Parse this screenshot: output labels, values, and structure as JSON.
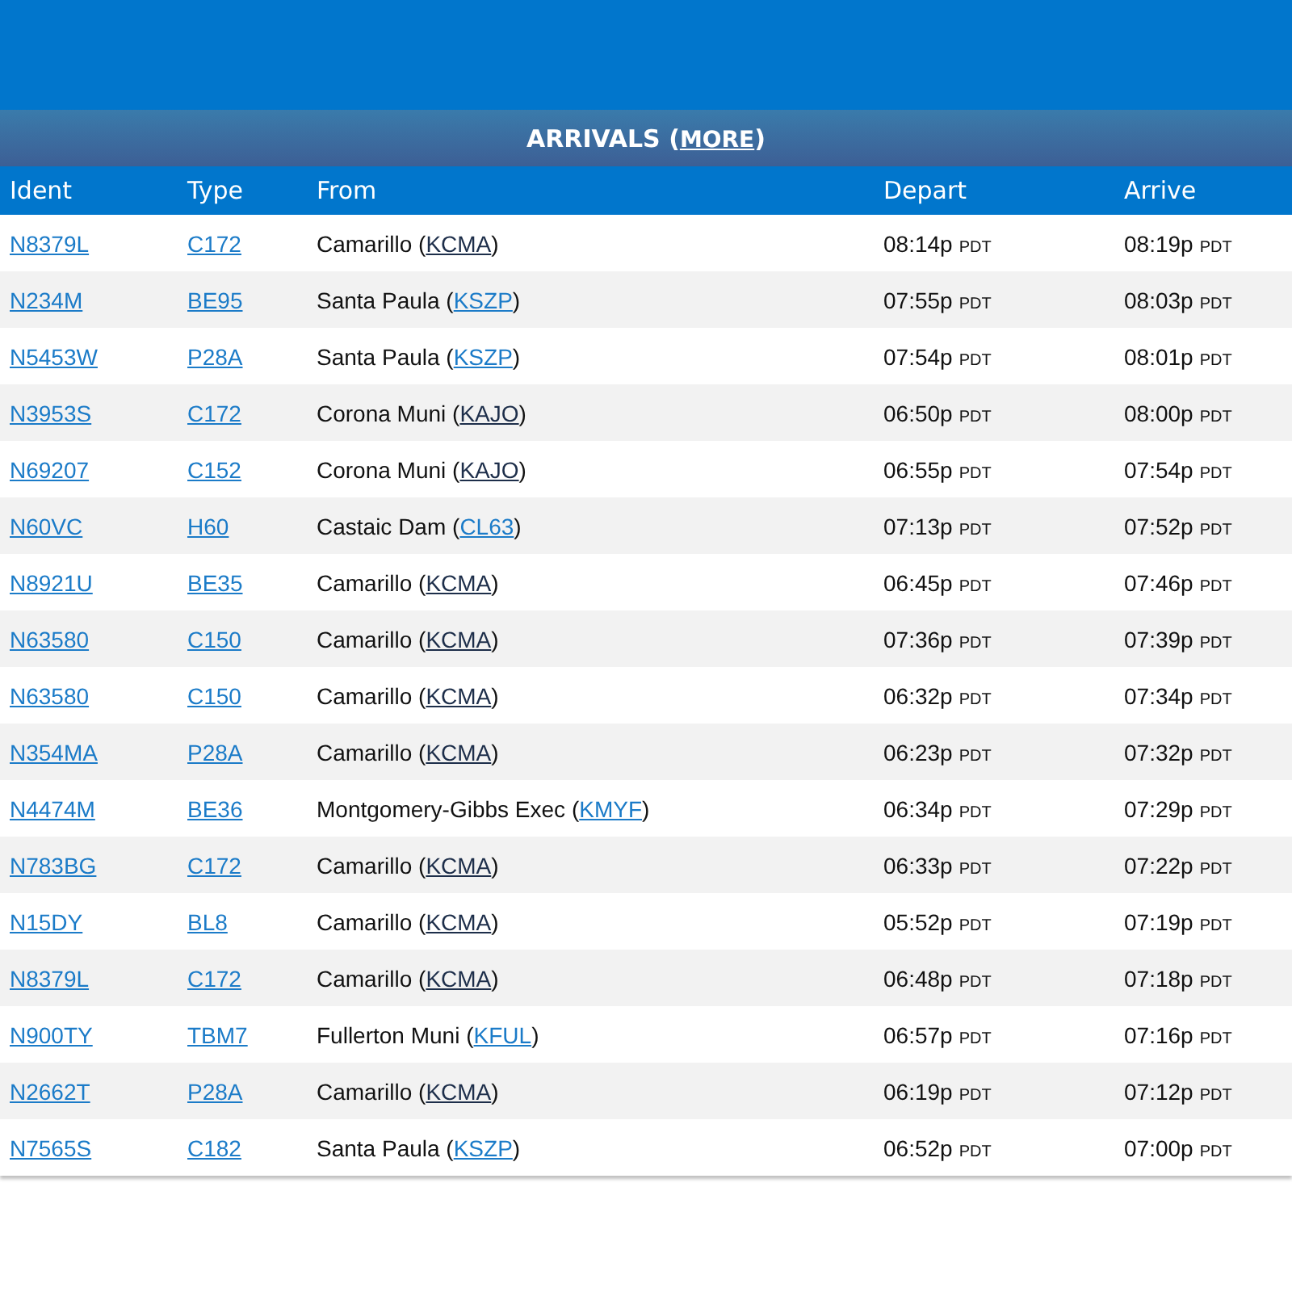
{
  "title": "ARRIVALS (",
  "more_link": "MORE",
  "title_end": ")",
  "columns": [
    "Ident",
    "Type",
    "From",
    "Depart",
    "Arrive"
  ],
  "rows": [
    {
      "ident": "N8379L",
      "type": "C172",
      "from": "Camarillo (",
      "airport": "KCMA",
      "from_end": ")",
      "airport_visited": true,
      "depart": "08:14p",
      "depart_zone": "PDT",
      "arrive": "08:19p",
      "arrive_zone": "PDT"
    },
    {
      "ident": "N234M",
      "type": "BE95",
      "from": "Santa Paula (",
      "airport": "KSZP",
      "from_end": ")",
      "airport_visited": false,
      "depart": "07:55p",
      "depart_zone": "PDT",
      "arrive": "08:03p",
      "arrive_zone": "PDT"
    },
    {
      "ident": "N5453W",
      "type": "P28A",
      "from": "Santa Paula (",
      "airport": "KSZP",
      "from_end": ")",
      "airport_visited": false,
      "depart": "07:54p",
      "depart_zone": "PDT",
      "arrive": "08:01p",
      "arrive_zone": "PDT"
    },
    {
      "ident": "N3953S",
      "type": "C172",
      "from": "Corona Muni (",
      "airport": "KAJO",
      "from_end": ")",
      "airport_visited": true,
      "depart": "06:50p",
      "depart_zone": "PDT",
      "arrive": "08:00p",
      "arrive_zone": "PDT"
    },
    {
      "ident": "N69207",
      "type": "C152",
      "from": "Corona Muni (",
      "airport": "KAJO",
      "from_end": ")",
      "airport_visited": true,
      "depart": "06:55p",
      "depart_zone": "PDT",
      "arrive": "07:54p",
      "arrive_zone": "PDT"
    },
    {
      "ident": "N60VC",
      "type": "H60",
      "from": "Castaic Dam (",
      "airport": "CL63",
      "from_end": ")",
      "airport_visited": false,
      "depart": "07:13p",
      "depart_zone": "PDT",
      "arrive": "07:52p",
      "arrive_zone": "PDT"
    },
    {
      "ident": "N8921U",
      "type": "BE35",
      "from": "Camarillo (",
      "airport": "KCMA",
      "from_end": ")",
      "airport_visited": true,
      "depart": "06:45p",
      "depart_zone": "PDT",
      "arrive": "07:46p",
      "arrive_zone": "PDT"
    },
    {
      "ident": "N63580",
      "type": "C150",
      "from": "Camarillo (",
      "airport": "KCMA",
      "from_end": ")",
      "airport_visited": true,
      "depart": "07:36p",
      "depart_zone": "PDT",
      "arrive": "07:39p",
      "arrive_zone": "PDT"
    },
    {
      "ident": "N63580",
      "type": "C150",
      "from": "Camarillo (",
      "airport": "KCMA",
      "from_end": ")",
      "airport_visited": true,
      "depart": "06:32p",
      "depart_zone": "PDT",
      "arrive": "07:34p",
      "arrive_zone": "PDT"
    },
    {
      "ident": "N354MA",
      "type": "P28A",
      "from": "Camarillo (",
      "airport": "KCMA",
      "from_end": ")",
      "airport_visited": true,
      "depart": "06:23p",
      "depart_zone": "PDT",
      "arrive": "07:32p",
      "arrive_zone": "PDT"
    },
    {
      "ident": "N4474M",
      "type": "BE36",
      "from": "Montgomery-Gibbs Exec (",
      "airport": "KMYF",
      "from_end": ")",
      "airport_visited": false,
      "depart": "06:34p",
      "depart_zone": "PDT",
      "arrive": "07:29p",
      "arrive_zone": "PDT"
    },
    {
      "ident": "N783BG",
      "type": "C172",
      "from": "Camarillo (",
      "airport": "KCMA",
      "from_end": ")",
      "airport_visited": true,
      "depart": "06:33p",
      "depart_zone": "PDT",
      "arrive": "07:22p",
      "arrive_zone": "PDT"
    },
    {
      "ident": "N15DY",
      "type": "BL8",
      "from": "Camarillo (",
      "airport": "KCMA",
      "from_end": ")",
      "airport_visited": true,
      "depart": "05:52p",
      "depart_zone": "PDT",
      "arrive": "07:19p",
      "arrive_zone": "PDT"
    },
    {
      "ident": "N8379L",
      "type": "C172",
      "from": "Camarillo (",
      "airport": "KCMA",
      "from_end": ")",
      "airport_visited": true,
      "depart": "06:48p",
      "depart_zone": "PDT",
      "arrive": "07:18p",
      "arrive_zone": "PDT"
    },
    {
      "ident": "N900TY",
      "type": "TBM7",
      "from": "Fullerton Muni (",
      "airport": "KFUL",
      "from_end": ")",
      "airport_visited": false,
      "depart": "06:57p",
      "depart_zone": "PDT",
      "arrive": "07:16p",
      "arrive_zone": "PDT"
    },
    {
      "ident": "N2662T",
      "type": "P28A",
      "from": "Camarillo (",
      "airport": "KCMA",
      "from_end": ")",
      "airport_visited": true,
      "depart": "06:19p",
      "depart_zone": "PDT",
      "arrive": "07:12p",
      "arrive_zone": "PDT"
    },
    {
      "ident": "N7565S",
      "type": "C182",
      "from": "Santa Paula (",
      "airport": "KSZP",
      "from_end": ")",
      "airport_visited": false,
      "depart": "06:52p",
      "depart_zone": "PDT",
      "arrive": "07:00p",
      "arrive_zone": "PDT"
    }
  ]
}
